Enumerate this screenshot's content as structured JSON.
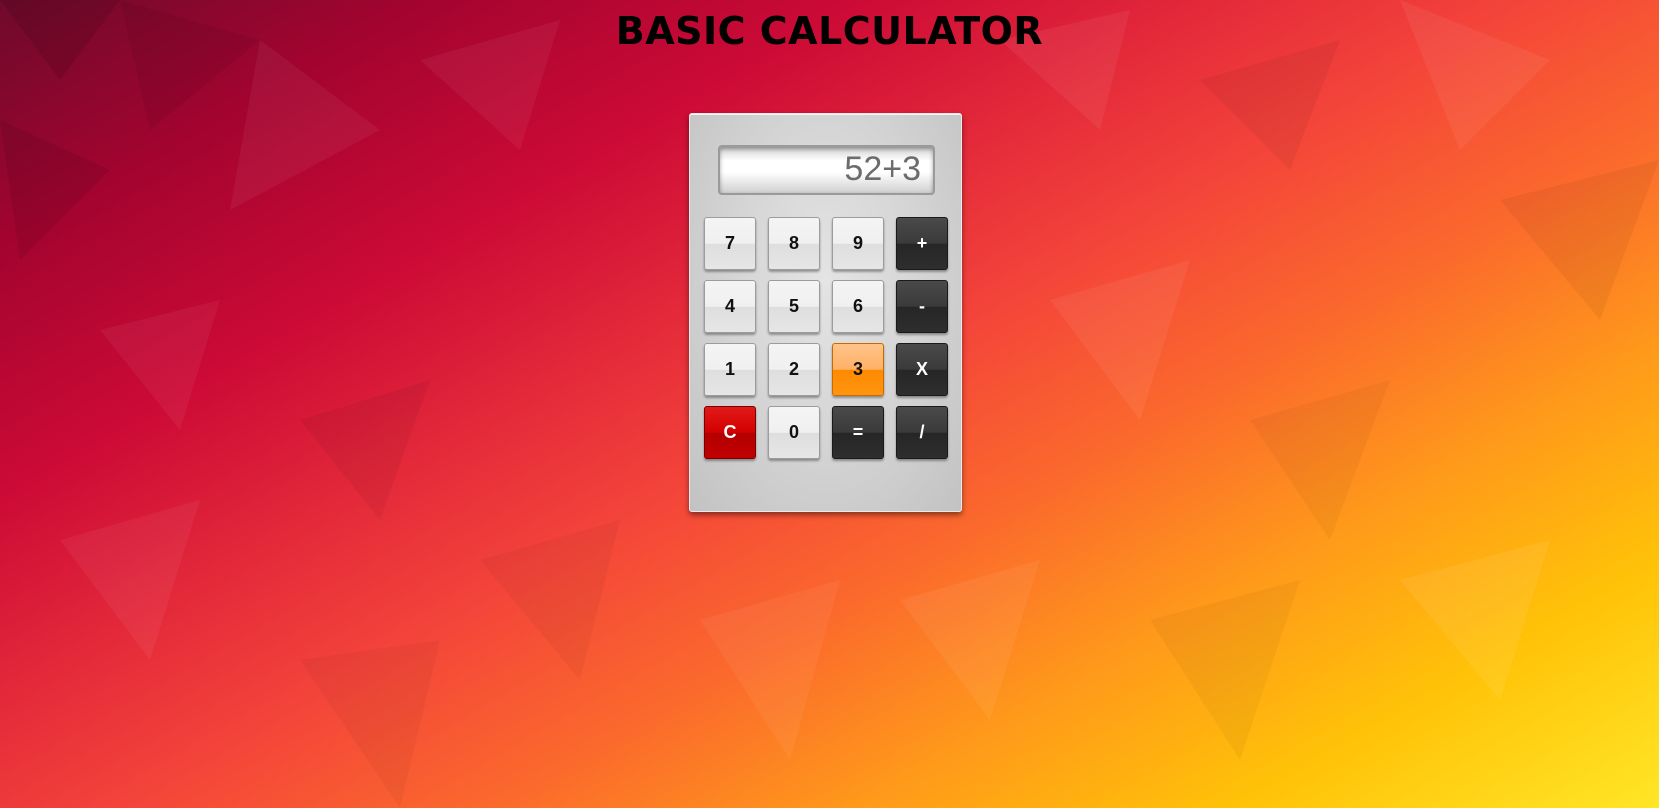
{
  "page": {
    "title": "BASIC CALCULATOR"
  },
  "calculator": {
    "display_value": "52+3",
    "keys": [
      {
        "label": "7",
        "style": "light"
      },
      {
        "label": "8",
        "style": "light"
      },
      {
        "label": "9",
        "style": "light"
      },
      {
        "label": "+",
        "style": "dark"
      },
      {
        "label": "4",
        "style": "light"
      },
      {
        "label": "5",
        "style": "light"
      },
      {
        "label": "6",
        "style": "light"
      },
      {
        "label": "-",
        "style": "dark"
      },
      {
        "label": "1",
        "style": "light"
      },
      {
        "label": "2",
        "style": "light"
      },
      {
        "label": "3",
        "style": "active"
      },
      {
        "label": "X",
        "style": "dark"
      },
      {
        "label": "C",
        "style": "red"
      },
      {
        "label": "0",
        "style": "light"
      },
      {
        "label": "=",
        "style": "dark"
      },
      {
        "label": "/",
        "style": "dark"
      }
    ]
  },
  "colors": {
    "clear_key": "#d30000",
    "active_key": "#ff8a00",
    "operator_key": "#2e2e2e",
    "digit_key": "#e8e8e8",
    "display_text": "#6c6c6c"
  }
}
